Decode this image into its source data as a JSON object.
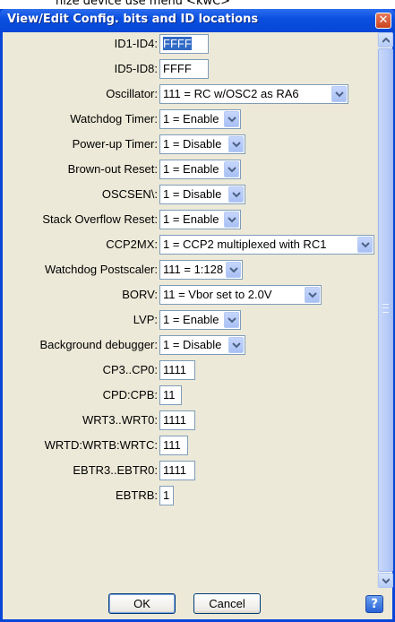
{
  "top_fragment": "nize device use menu <kwC>",
  "window": {
    "title": "View/Edit Config. bits and ID locations",
    "close_glyph": "✕"
  },
  "rows": [
    {
      "label": "ID1-ID4:",
      "value": "FFFF",
      "kind": "text",
      "selected": true
    },
    {
      "label": "ID5-ID8:",
      "value": "FFFF",
      "kind": "text"
    },
    {
      "label": "Oscillator:",
      "value": "111 = RC w/OSC2 as RA6",
      "kind": "combo"
    },
    {
      "label": "Watchdog Timer:",
      "value": "1 = Enable",
      "kind": "combo"
    },
    {
      "label": "Power-up Timer:",
      "value": "1 = Disable",
      "kind": "combo"
    },
    {
      "label": "Brown-out Reset:",
      "value": "1 = Enable",
      "kind": "combo"
    },
    {
      "label": "OSCSEN\\:",
      "value": "1 = Disable",
      "kind": "combo"
    },
    {
      "label": "Stack Overflow Reset:",
      "value": "1 = Enable",
      "kind": "combo"
    },
    {
      "label": "CCP2MX:",
      "value": "1 = CCP2 multiplexed with RC1",
      "kind": "combo"
    },
    {
      "label": "Watchdog Postscaler:",
      "value": "111 = 1:128",
      "kind": "combo"
    },
    {
      "label": "BORV:",
      "value": "11 = Vbor set to 2.0V",
      "kind": "combo"
    },
    {
      "label": "LVP:",
      "value": "1 = Enable",
      "kind": "combo"
    },
    {
      "label": "Background debugger:",
      "value": "1 = Disable",
      "kind": "combo"
    },
    {
      "label": "CP3..CP0:",
      "value": "1111",
      "kind": "text"
    },
    {
      "label": "CPD:CPB:",
      "value": "11",
      "kind": "text"
    },
    {
      "label": "WRT3..WRT0:",
      "value": "1111",
      "kind": "text"
    },
    {
      "label": "WRTD:WRTB:WRTC:",
      "value": "111",
      "kind": "text"
    },
    {
      "label": "EBTR3..EBTR0:",
      "value": "1111",
      "kind": "text"
    },
    {
      "label": "EBTRB:",
      "value": "1",
      "kind": "text"
    }
  ],
  "buttons": {
    "ok": "OK",
    "cancel": "Cancel",
    "help_glyph": "?"
  },
  "icons": {
    "close": "close-icon",
    "dropdown": "chevron-down-icon",
    "scroll_up": "chevron-up-icon",
    "scroll_down": "chevron-down-icon",
    "help": "help-icon"
  },
  "colors": {
    "title_bar": "#0a50e0",
    "dialog_bg": "#ece9d8",
    "selection": "#316ac5"
  }
}
